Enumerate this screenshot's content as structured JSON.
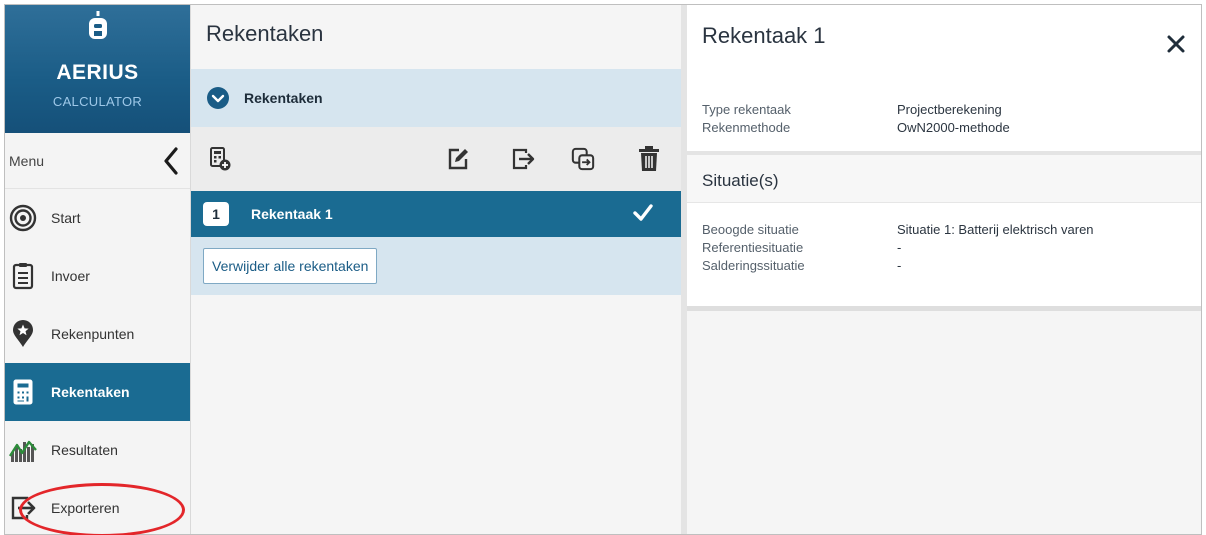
{
  "brand": {
    "name": "AERIUS",
    "subtitle": "CALCULATOR"
  },
  "menu": {
    "label": "Menu",
    "items": [
      {
        "label": "Start",
        "icon": "target-icon"
      },
      {
        "label": "Invoer",
        "icon": "clipboard-icon"
      },
      {
        "label": "Rekenpunten",
        "icon": "map-pin-star-icon"
      },
      {
        "label": "Rekentaken",
        "icon": "calculator-icon",
        "active": true
      },
      {
        "label": "Resultaten",
        "icon": "results-chart-icon"
      },
      {
        "label": "Exporteren",
        "icon": "export-icon"
      }
    ]
  },
  "middle": {
    "title": "Rekentaken",
    "group_label": "Rekentaken",
    "task": {
      "number": "1",
      "name": "Rekentaak 1"
    },
    "delete_all_label": "Verwijder alle rekentaken"
  },
  "detail": {
    "title": "Rekentaak 1",
    "type_label": "Type rekentaak",
    "type_value": "Projectberekening",
    "method_label": "Rekenmethode",
    "method_value": "OwN2000-methode",
    "situations_title": "Situatie(s)",
    "situations": [
      {
        "label": "Beoogde situatie",
        "value": "Situatie 1: Batterij elektrisch varen"
      },
      {
        "label": "Referentiesituatie",
        "value": "-"
      },
      {
        "label": "Salderingssituatie",
        "value": "-"
      }
    ]
  },
  "colors": {
    "brand": "#1a5c86",
    "active": "#1a6b92",
    "section": "#d6e5ef",
    "highlight": "#e3262a"
  }
}
